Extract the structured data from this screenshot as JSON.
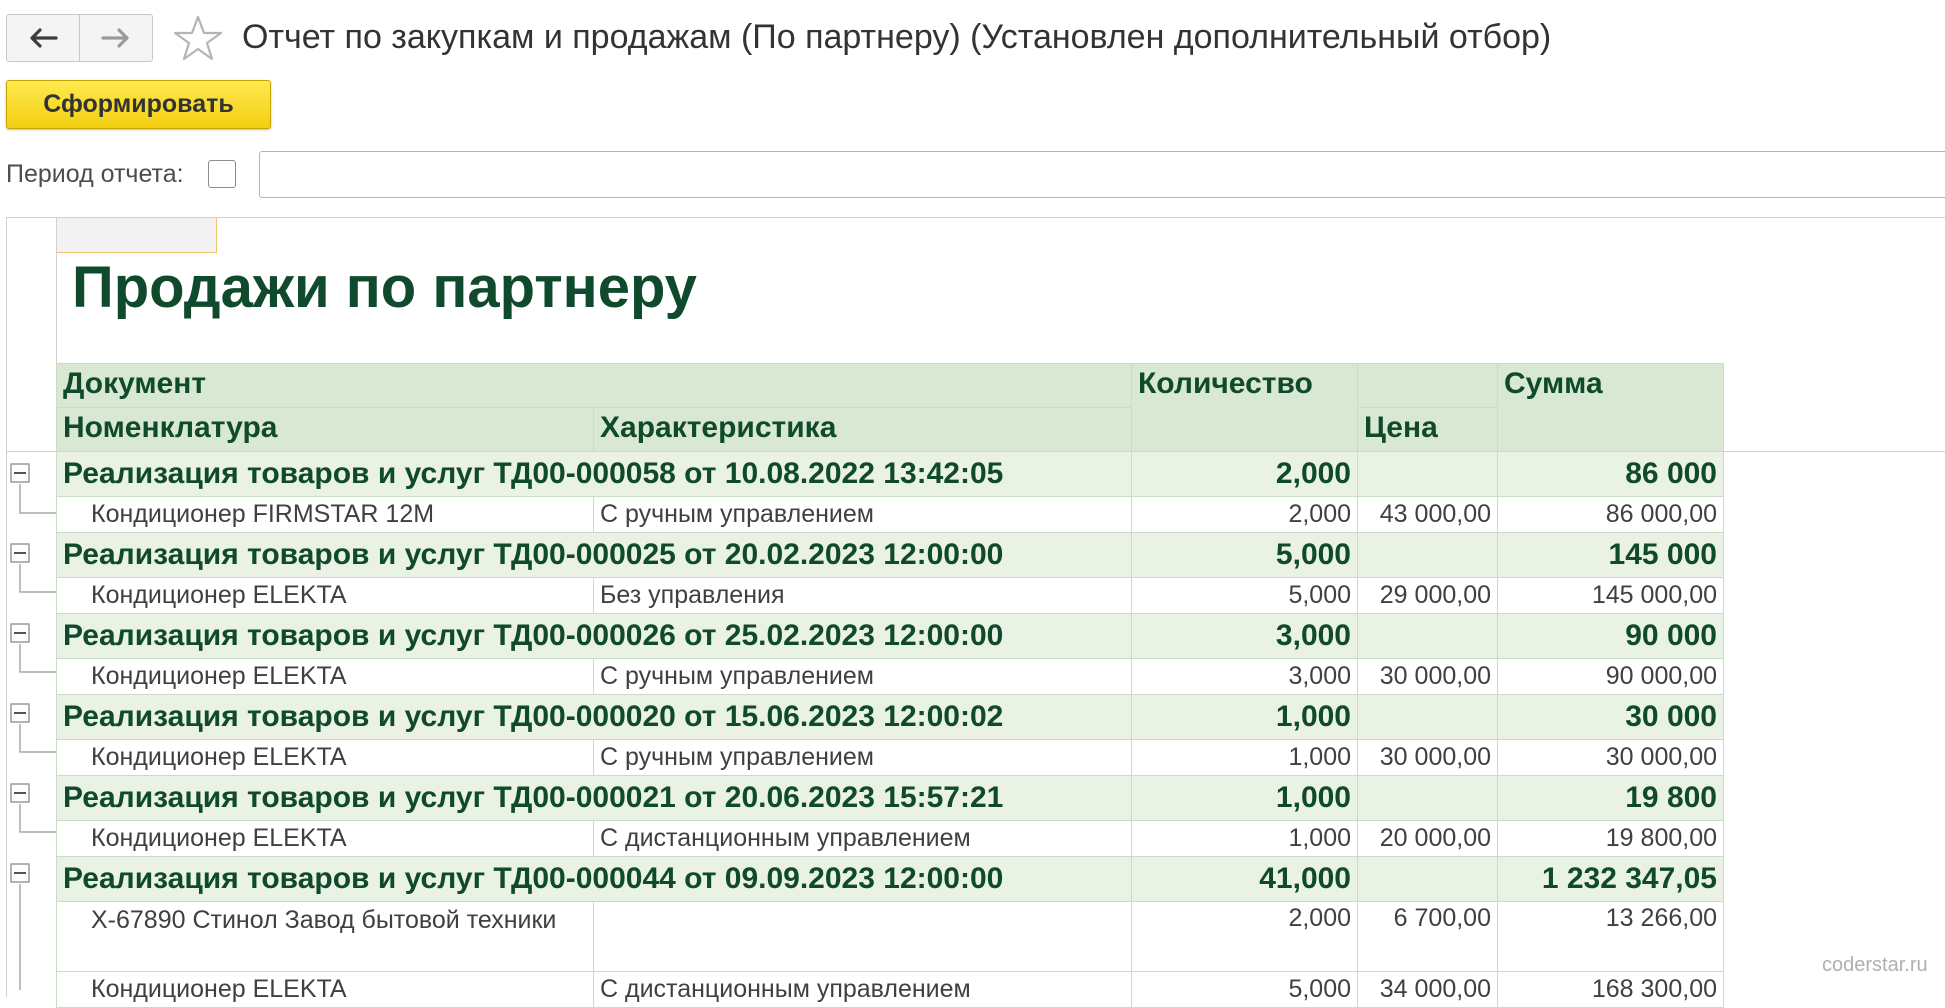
{
  "window": {
    "title": "Отчет по закупкам и продажам (По партнеру) (Установлен дополнительный отбор)"
  },
  "icons": {
    "back": "arrow-left-icon",
    "forward": "arrow-right-icon",
    "favorite": "star-outline-icon",
    "collapse": "minus-box-icon"
  },
  "toolbar": {
    "generate_label": "Сформировать"
  },
  "filters": {
    "period_label": "Период отчета:",
    "period_checked": false,
    "period_value": ""
  },
  "colors": {
    "accent_yellow": "#f2cf10",
    "report_title": "#104a2c",
    "header_bg": "#d8e8d2",
    "group_bg": "#e9f2e5"
  },
  "report": {
    "title": "Продажи по партнеру",
    "headers": {
      "document": "Документ",
      "nomenclature": "Номенклатура",
      "characteristic": "Характеристика",
      "quantity": "Количество",
      "price": "Цена",
      "amount": "Сумма"
    },
    "groups": [
      {
        "document": "Реализация товаров и услуг ТД00-000058 от 10.08.2022 13:42:05",
        "quantity": "2,000",
        "amount": "86 000",
        "items": [
          {
            "name": "Кондиционер FIRMSTAR 12M",
            "characteristic": "С ручным управлением",
            "quantity": "2,000",
            "price": "43 000,00",
            "amount": "86 000,00"
          }
        ]
      },
      {
        "document": "Реализация товаров и услуг ТД00-000025 от 20.02.2023 12:00:00",
        "quantity": "5,000",
        "amount": "145 000",
        "items": [
          {
            "name": "Кондиционер ELEKTA",
            "characteristic": "Без управления",
            "quantity": "5,000",
            "price": "29 000,00",
            "amount": "145 000,00"
          }
        ]
      },
      {
        "document": "Реализация товаров и услуг ТД00-000026 от 25.02.2023 12:00:00",
        "quantity": "3,000",
        "amount": "90 000",
        "items": [
          {
            "name": "Кондиционер ELEKTA",
            "characteristic": "С ручным управлением",
            "quantity": "3,000",
            "price": "30 000,00",
            "amount": "90 000,00"
          }
        ]
      },
      {
        "document": "Реализация товаров и услуг ТД00-000020 от 15.06.2023 12:00:02",
        "quantity": "1,000",
        "amount": "30 000",
        "items": [
          {
            "name": "Кондиционер ELEKTA",
            "characteristic": "С ручным управлением",
            "quantity": "1,000",
            "price": "30 000,00",
            "amount": "30 000,00"
          }
        ]
      },
      {
        "document": "Реализация товаров и услуг ТД00-000021 от 20.06.2023 15:57:21",
        "quantity": "1,000",
        "amount": "19 800",
        "items": [
          {
            "name": "Кондиционер ELEKTA",
            "characteristic": "С дистанционным управлением",
            "quantity": "1,000",
            "price": "20 000,00",
            "amount": "19 800,00"
          }
        ]
      },
      {
        "document": "Реализация товаров и услуг ТД00-000044 от 09.09.2023 12:00:00",
        "quantity": "41,000",
        "amount": "1 232 347,05",
        "items": [
          {
            "name": "X-67890 Стинол Завод бытовой техники",
            "characteristic": "",
            "quantity": "2,000",
            "price": "6 700,00",
            "amount": "13 266,00"
          },
          {
            "name": "Кондиционер ELEKTA",
            "characteristic": "С дистанционным управлением",
            "quantity": "5,000",
            "price": "34 000,00",
            "amount": "168 300,00"
          }
        ]
      }
    ]
  },
  "watermark": "coderstar.ru"
}
